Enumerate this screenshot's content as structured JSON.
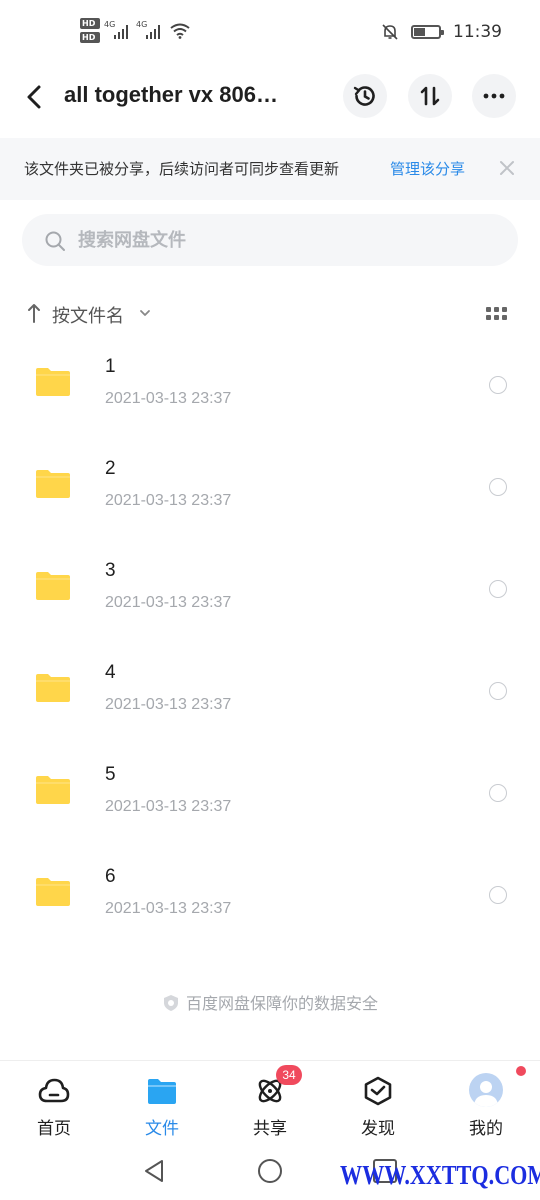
{
  "status_bar": {
    "hd_labels": [
      "HD",
      "HD"
    ],
    "sim1_label": "4G",
    "sim2_label": "4G",
    "time": "11:39",
    "battery_level": 0.45,
    "icons": [
      "signal-icon",
      "wifi-icon",
      "mute-bell-icon",
      "battery-icon"
    ]
  },
  "header": {
    "title": "all together  vx 806…",
    "actions": [
      "history-icon",
      "transfer-icon",
      "more-icon"
    ]
  },
  "share_banner": {
    "text": "该文件夹已被分享，后续访问者可同步查看更新",
    "link_label": "管理该分享"
  },
  "search": {
    "placeholder": "搜索网盘文件"
  },
  "sort": {
    "label": "按文件名"
  },
  "files": [
    {
      "name": "1",
      "date": "2021-03-13  23:37"
    },
    {
      "name": "2",
      "date": "2021-03-13  23:37"
    },
    {
      "name": "3",
      "date": "2021-03-13  23:37"
    },
    {
      "name": "4",
      "date": "2021-03-13  23:37"
    },
    {
      "name": "5",
      "date": "2021-03-13  23:37"
    },
    {
      "name": "6",
      "date": "2021-03-13  23:37"
    }
  ],
  "footer_note": "百度网盘保障你的数据安全",
  "tabs": [
    {
      "label": "首页",
      "icon": "cloud-icon"
    },
    {
      "label": "文件",
      "icon": "folder-icon",
      "active": true
    },
    {
      "label": "共享",
      "icon": "atom-icon",
      "badge": "34"
    },
    {
      "label": "发现",
      "icon": "cube-icon"
    },
    {
      "label": "我的",
      "icon": "avatar-icon"
    }
  ],
  "colors": {
    "accent": "#2a8ae8",
    "folder": "#ffd64a",
    "badge": "#f04a5d"
  },
  "watermark": "WWW.XXTTQ.COM"
}
